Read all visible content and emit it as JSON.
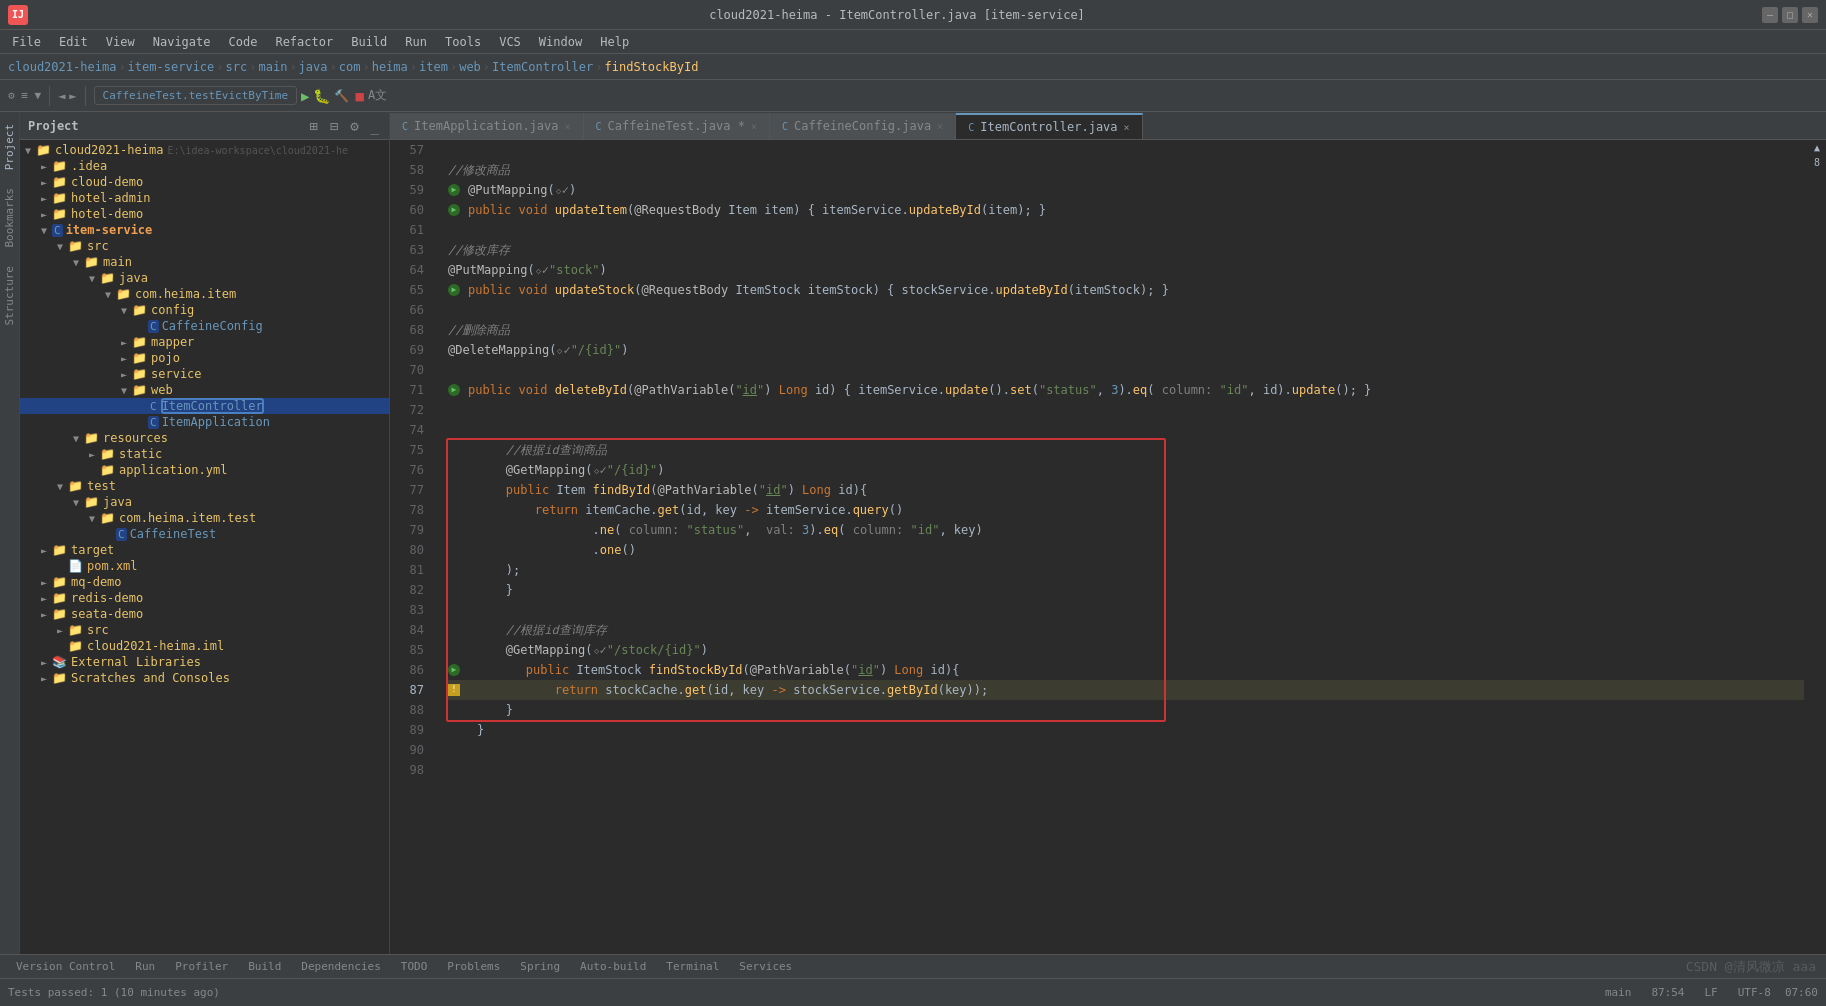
{
  "window": {
    "title": "cloud2021-heima - ItemController.java [item-service]",
    "min_label": "—",
    "max_label": "□",
    "close_label": "✕"
  },
  "menubar": {
    "items": [
      "File",
      "Edit",
      "View",
      "Navigate",
      "Code",
      "Refactor",
      "Build",
      "Run",
      "Tools",
      "VCS",
      "Window",
      "Help"
    ]
  },
  "breadcrumb": {
    "items": [
      "cloud2021-heima",
      "item-service",
      "src",
      "main",
      "java",
      "com",
      "heima",
      "item",
      "web",
      "ItemController",
      "findStockById"
    ]
  },
  "toolbar": {
    "run_config": "CaffeineTest.testEvictByTime",
    "run_btn": "▶",
    "build_btn": "🔨"
  },
  "sidebar": {
    "title": "Project",
    "tree": [
      {
        "indent": 0,
        "type": "folder",
        "label": "cloud2021-heima",
        "path": "E:\\idea-workspace\\cloud2021-he",
        "expanded": true
      },
      {
        "indent": 1,
        "type": "folder",
        "label": ".idea",
        "expanded": false
      },
      {
        "indent": 1,
        "type": "folder",
        "label": "cloud-demo",
        "expanded": false
      },
      {
        "indent": 1,
        "type": "folder",
        "label": "hotel-admin",
        "expanded": false
      },
      {
        "indent": 1,
        "type": "folder",
        "label": "hotel-demo",
        "expanded": false
      },
      {
        "indent": 1,
        "type": "module",
        "label": "item-service",
        "expanded": true,
        "selected": false
      },
      {
        "indent": 2,
        "type": "src-folder",
        "label": "src",
        "expanded": true
      },
      {
        "indent": 3,
        "type": "folder",
        "label": "main",
        "expanded": true
      },
      {
        "indent": 4,
        "type": "folder",
        "label": "java",
        "expanded": true
      },
      {
        "indent": 5,
        "type": "folder",
        "label": "com.heima.item",
        "expanded": true
      },
      {
        "indent": 6,
        "type": "folder",
        "label": "config",
        "expanded": true
      },
      {
        "indent": 7,
        "type": "class",
        "label": "CaffeineConfig",
        "expanded": false
      },
      {
        "indent": 6,
        "type": "folder",
        "label": "mapper",
        "expanded": false
      },
      {
        "indent": 6,
        "type": "folder",
        "label": "pojo",
        "expanded": false
      },
      {
        "indent": 6,
        "type": "folder",
        "label": "service",
        "expanded": false
      },
      {
        "indent": 6,
        "type": "folder",
        "label": "web",
        "expanded": true
      },
      {
        "indent": 7,
        "type": "class",
        "label": "ItemController",
        "selected": true
      },
      {
        "indent": 7,
        "type": "class",
        "label": "ItemApplication"
      },
      {
        "indent": 3,
        "type": "folder",
        "label": "resources",
        "expanded": true
      },
      {
        "indent": 4,
        "type": "folder",
        "label": "static",
        "expanded": false
      },
      {
        "indent": 4,
        "type": "file",
        "label": "application.yml"
      },
      {
        "indent": 2,
        "type": "test-folder",
        "label": "test",
        "expanded": true
      },
      {
        "indent": 3,
        "type": "folder",
        "label": "java",
        "expanded": true
      },
      {
        "indent": 4,
        "type": "folder",
        "label": "com.heima.item.test",
        "expanded": true
      },
      {
        "indent": 5,
        "type": "class",
        "label": "CaffeineTest"
      },
      {
        "indent": 1,
        "type": "folder",
        "label": "target",
        "expanded": false
      },
      {
        "indent": 2,
        "type": "xml",
        "label": "pom.xml"
      },
      {
        "indent": 1,
        "type": "folder",
        "label": "mq-demo",
        "expanded": false
      },
      {
        "indent": 1,
        "type": "folder",
        "label": "redis-demo",
        "expanded": false
      },
      {
        "indent": 1,
        "type": "folder",
        "label": "seata-demo",
        "expanded": false
      },
      {
        "indent": 2,
        "type": "folder",
        "label": "src",
        "expanded": false
      },
      {
        "indent": 2,
        "type": "iml",
        "label": "cloud2021-heima.iml"
      },
      {
        "indent": 1,
        "type": "ext-lib",
        "label": "External Libraries",
        "expanded": false
      },
      {
        "indent": 1,
        "type": "folder",
        "label": "Scratches and Consoles",
        "expanded": false
      }
    ]
  },
  "tabs": [
    {
      "label": "ItemApplication.java",
      "active": false,
      "closable": true
    },
    {
      "label": "CaffeineTest.java",
      "active": false,
      "closable": true,
      "modified": true
    },
    {
      "label": "CaffeineConfig.java",
      "active": false,
      "closable": true
    },
    {
      "label": "ItemController.java",
      "active": true,
      "closable": true
    }
  ],
  "code": {
    "lines": [
      {
        "n": 57,
        "text": ""
      },
      {
        "n": 58,
        "text": "    <comment>//修改商品</comment>"
      },
      {
        "n": 59,
        "text": "    <annotation>@PutMapping</annotation><op>(</op><ann_v>◇✓</ann_v><op>)</op>",
        "gutter": "run"
      },
      {
        "n": 60,
        "text": "    <kw>public</kw> <kw>void</kw> <method>updateItem</method>(<annotation>@RequestBody</annotation> Item item) { itemService.updateById(item); }",
        "gutter": "run"
      },
      {
        "n": 61,
        "text": ""
      },
      {
        "n": 63,
        "text": "    <comment>//修改库存</comment>"
      },
      {
        "n": 64,
        "text": "    <annotation>@PutMapping</annotation>(<ann_v>◇✓\"stock\"</ann_v>)"
      },
      {
        "n": 65,
        "text": "    <kw>public</kw> <kw>void</kw> <method>updateStock</method>(<annotation>@RequestBody</annotation> ItemStock itemStock) { stockService.updateById(itemStock); }",
        "gutter": "run"
      },
      {
        "n": 66,
        "text": ""
      },
      {
        "n": 68,
        "text": "    <comment>//删除商品</comment>"
      },
      {
        "n": 69,
        "text": "    <annotation>@DeleteMapping</annotation>(<ann_v>◇✓\"/{{id}}\"</ann_v>)"
      },
      {
        "n": 70,
        "text": ""
      },
      {
        "n": 71,
        "text": "    <kw>public</kw> <kw>void</kw> <method>deleteById</method>(<annotation>@PathVariable</annotation>(\"<u>id</u>\") Long id) { itemService.update().set(\"status\", 3).eq( column: \"id\", id).update(); }",
        "gutter": "run"
      },
      {
        "n": 72,
        "text": ""
      },
      {
        "n": 74,
        "text": ""
      },
      {
        "n": 75,
        "text": "        <comment>//根据id查询商品</comment>"
      },
      {
        "n": 76,
        "text": "        <annotation>@GetMapping</annotation>(<ann_v>◇✓\"/{{id}}\"</ann_v>)"
      },
      {
        "n": 77,
        "text": "        <kw>public</kw> Item <method>findById</method>(<annotation>@PathVariable</annotation>(\"<u>id</u>\") Long id){"
      },
      {
        "n": 78,
        "text": "            <kw>return</kw> itemCache.get(id, key -> itemService.query()"
      },
      {
        "n": 79,
        "text": "                    .ne( column: \"status\",  val: 3).eq( column: \"id\", key)"
      },
      {
        "n": 80,
        "text": "                    .one()"
      },
      {
        "n": 81,
        "text": "        );"
      },
      {
        "n": 82,
        "text": "        }"
      },
      {
        "n": 83,
        "text": ""
      },
      {
        "n": 84,
        "text": "        <comment>//根据id查询库存</comment>"
      },
      {
        "n": 85,
        "text": "        <annotation>@GetMapping</annotation>(<ann_v>◇✓\"/stock/{{id}}\"</ann_v>)"
      },
      {
        "n": 86,
        "text": "        <kw>public</kw> ItemStock <method>findStockById</method>(<annotation>@PathVariable</annotation>(\"<u>id</u>\") Long id){",
        "gutter": "run"
      },
      {
        "n": 87,
        "text": "            <kw>return</kw> stockCache.get(id, key -> stockService.getById(key));",
        "gutter": "warn"
      },
      {
        "n": 88,
        "text": "        }"
      },
      {
        "n": 89,
        "text": "    }"
      },
      {
        "n": 90,
        "text": ""
      },
      {
        "n": 98,
        "text": ""
      }
    ],
    "badge": "▲ 8"
  },
  "bottom_tabs": [
    {
      "label": "Version Control",
      "active": false
    },
    {
      "label": "Run",
      "active": false
    },
    {
      "label": "Profiler",
      "active": false
    },
    {
      "label": "Build",
      "active": false
    },
    {
      "label": "Dependencies",
      "active": false
    },
    {
      "label": "TODO",
      "active": false
    },
    {
      "label": "Problems",
      "active": false
    },
    {
      "label": "Spring",
      "active": false
    },
    {
      "label": "Auto-build",
      "active": false
    },
    {
      "label": "Terminal",
      "active": false
    },
    {
      "label": "Services",
      "active": false
    }
  ],
  "statusbar": {
    "run_text": "Tests passed: 1 (10 minutes ago)",
    "time": "07:60",
    "lf_text": "LF",
    "utf_text": "UTF-8",
    "git_text": "main",
    "line_col": "87:54"
  },
  "watermark": "CSDN @清风微凉 aaa"
}
